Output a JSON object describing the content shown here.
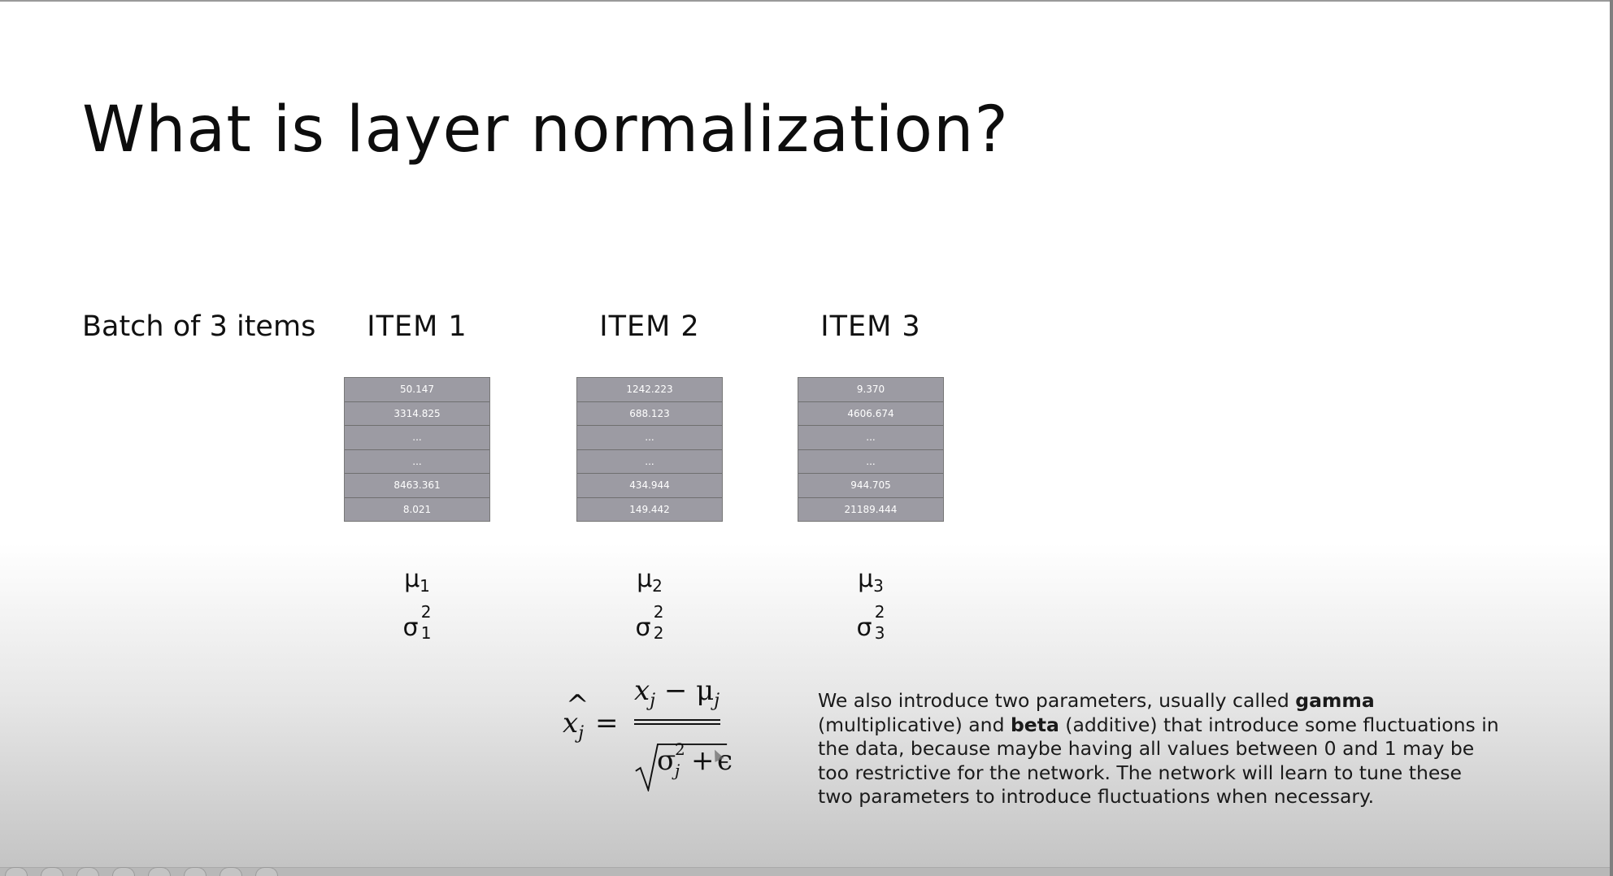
{
  "slide": {
    "title": "What is layer normalization?",
    "batch_label": "Batch of 3 items",
    "items": [
      {
        "header": "ITEM 1",
        "values": [
          "50.147",
          "3314.825",
          "...",
          "...",
          "8463.361",
          "8.021"
        ],
        "mu_symbol": "μ",
        "mu_index": "1",
        "sigma_symbol": "σ",
        "sigma_index": "1",
        "sigma_power": "2"
      },
      {
        "header": "ITEM 2",
        "values": [
          "1242.223",
          "688.123",
          "...",
          "...",
          "434.944",
          "149.442"
        ],
        "mu_symbol": "μ",
        "mu_index": "2",
        "sigma_symbol": "σ",
        "sigma_index": "2",
        "sigma_power": "2"
      },
      {
        "header": "ITEM 3",
        "values": [
          "9.370",
          "4606.674",
          "...",
          "...",
          "944.705",
          "21189.444"
        ],
        "mu_symbol": "μ",
        "mu_index": "3",
        "sigma_symbol": "σ",
        "sigma_index": "3",
        "sigma_power": "2"
      }
    ],
    "formula": {
      "lhs_var": "x",
      "lhs_hat": "^",
      "lhs_index": "j",
      "equals": "=",
      "num_var": "x",
      "num_index": "j",
      "minus": "−",
      "num_mu": "μ",
      "num_mu_index": "j",
      "den_sigma": "σ",
      "den_power": "2",
      "den_index": "j",
      "plus": "+",
      "epsilon": "ϵ"
    },
    "description": {
      "part1": "We also introduce two parameters, usually called ",
      "gamma": "gamma",
      "part2": " (multiplicative) and ",
      "beta": "beta",
      "part3": " (additive) that introduce some fluctuations in the data, because maybe having all values between 0 and 1 may be too restrictive for the network. The network will learn to tune these two parameters to introduce fluctuations when necessary."
    }
  }
}
